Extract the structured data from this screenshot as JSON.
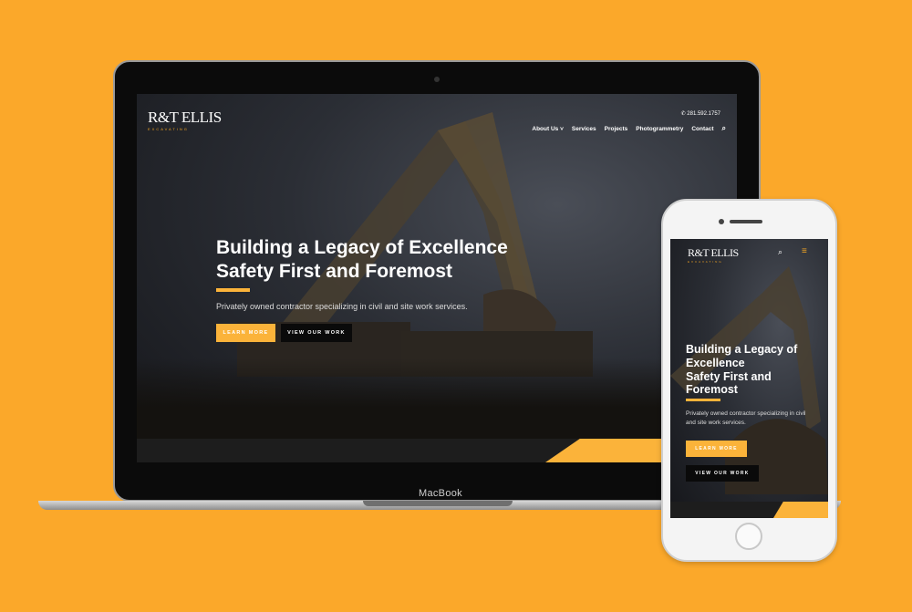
{
  "laptop": {
    "brand_label": "MacBook"
  },
  "site": {
    "logo": {
      "name": "R&T ELLIS",
      "sub": "EXCAVATING"
    },
    "phone": "281.592.1757",
    "nav": [
      "About Us",
      "Services",
      "Projects",
      "Photogrammetry",
      "Contact"
    ],
    "hero": {
      "line1": "Building a Legacy of Excellence",
      "line2": "Safety First and Foremost",
      "text": "Privately owned contractor specializing in civil and site work services.",
      "learn_more": "LEARN MORE",
      "view_work": "VIEW OUR WORK"
    },
    "mobile": {
      "line1a": "Building a Legacy of",
      "line1b": "Excellence",
      "line2a": "Safety First and",
      "line2b": "Foremost"
    }
  },
  "colors": {
    "background": "#fba82a",
    "accent": "#fbb33a"
  }
}
